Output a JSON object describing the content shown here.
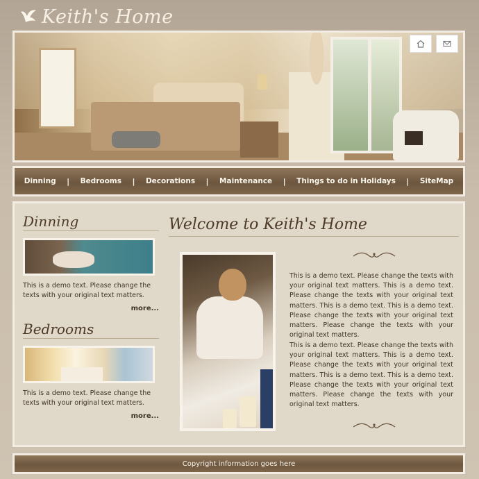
{
  "site": {
    "title": "Keith's Home"
  },
  "header_icons": [
    {
      "icon": "home-icon"
    },
    {
      "icon": "mail-icon"
    }
  ],
  "nav": {
    "items": [
      {
        "label": "Dinning"
      },
      {
        "label": "Bedrooms"
      },
      {
        "label": "Decorations"
      },
      {
        "label": "Maintenance"
      },
      {
        "label": "Things to do in Holidays"
      },
      {
        "label": "SiteMap"
      }
    ],
    "separator": "|"
  },
  "sidebar": {
    "sections": [
      {
        "title": "Dinning",
        "text": "This is a demo text. Please change the texts with your original text matters.",
        "more": "more..."
      },
      {
        "title": "Bedrooms",
        "text": "This is a demo text. Please change the texts with your original text matters.",
        "more": "more..."
      }
    ]
  },
  "main": {
    "title": "Welcome to Keith's Home",
    "paragraphs": [
      "This is a demo text. Please change the texts with your original text matters. This is a demo text. Please change the texts with your original text matters. This is a demo text. This is a demo text. Please change the texts with your original text matters. Please change the texts with your original text matters.",
      "This is a demo text. Please change the texts with your original text matters. This is a demo text. Please change the texts with your original text matters. This is a demo text. This is a demo text. Please change the texts with your original text matters. Please change the texts with your original text matters."
    ]
  },
  "footer": {
    "copyright": "Copyright information goes here"
  },
  "colors": {
    "nav_bg": "#6d573f",
    "content_bg": "#e0d8c8",
    "page_bg": "#c9bcaa",
    "heading": "#4d3a28"
  }
}
